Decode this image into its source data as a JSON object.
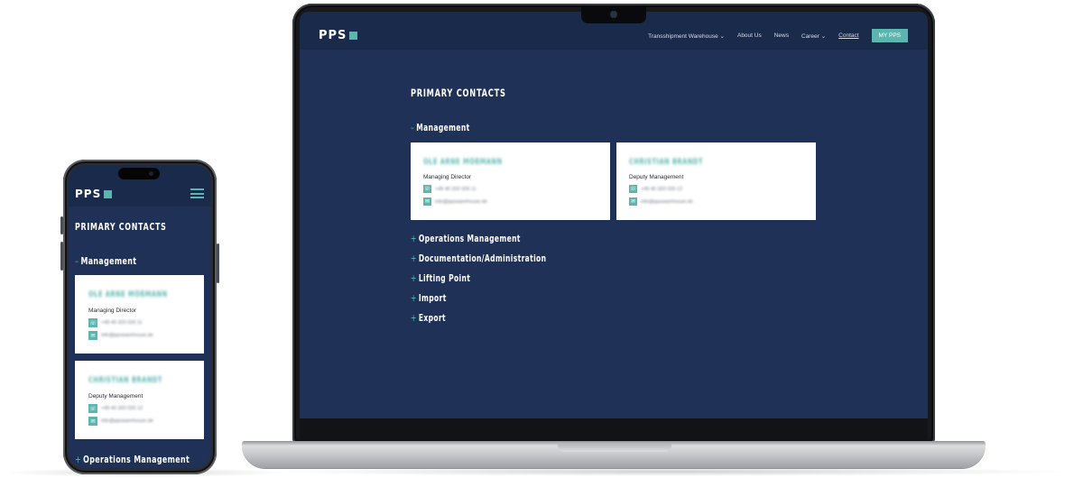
{
  "site": {
    "logo_text": "PPS",
    "nav": {
      "items": [
        "Transshipment Warehouse",
        "About Us",
        "News",
        "Career",
        "Contact"
      ],
      "dropdown_marker": "⌄",
      "button": "MY PPS"
    },
    "page_title": "PRIMARY CONTACTS",
    "sections": {
      "management": "Management",
      "operations": "Operations Management",
      "documentation": "Documentation/Administration",
      "lifting": "Lifting Point",
      "import": "Import",
      "export": "Export"
    },
    "expanded_sign": "–",
    "collapsed_sign": "+",
    "contacts": [
      {
        "name": "OLE ARNE MÖßMANN",
        "role": "Managing Director",
        "phone": "+49 40 320 026 11",
        "email": "info@ppswarehouse.de"
      },
      {
        "name": "CHRISTIAN BRANDT",
        "role": "Deputy Management",
        "phone": "+49 40 320 026 12",
        "email": "info@ppswarehouse.de"
      }
    ]
  },
  "colors": {
    "page_bg": "#1f3157",
    "header_bg": "#1a2a4b",
    "accent": "#5ab7b0",
    "card_bg": "#ffffff"
  },
  "icons": {
    "phone": "☏",
    "email": "✉"
  }
}
